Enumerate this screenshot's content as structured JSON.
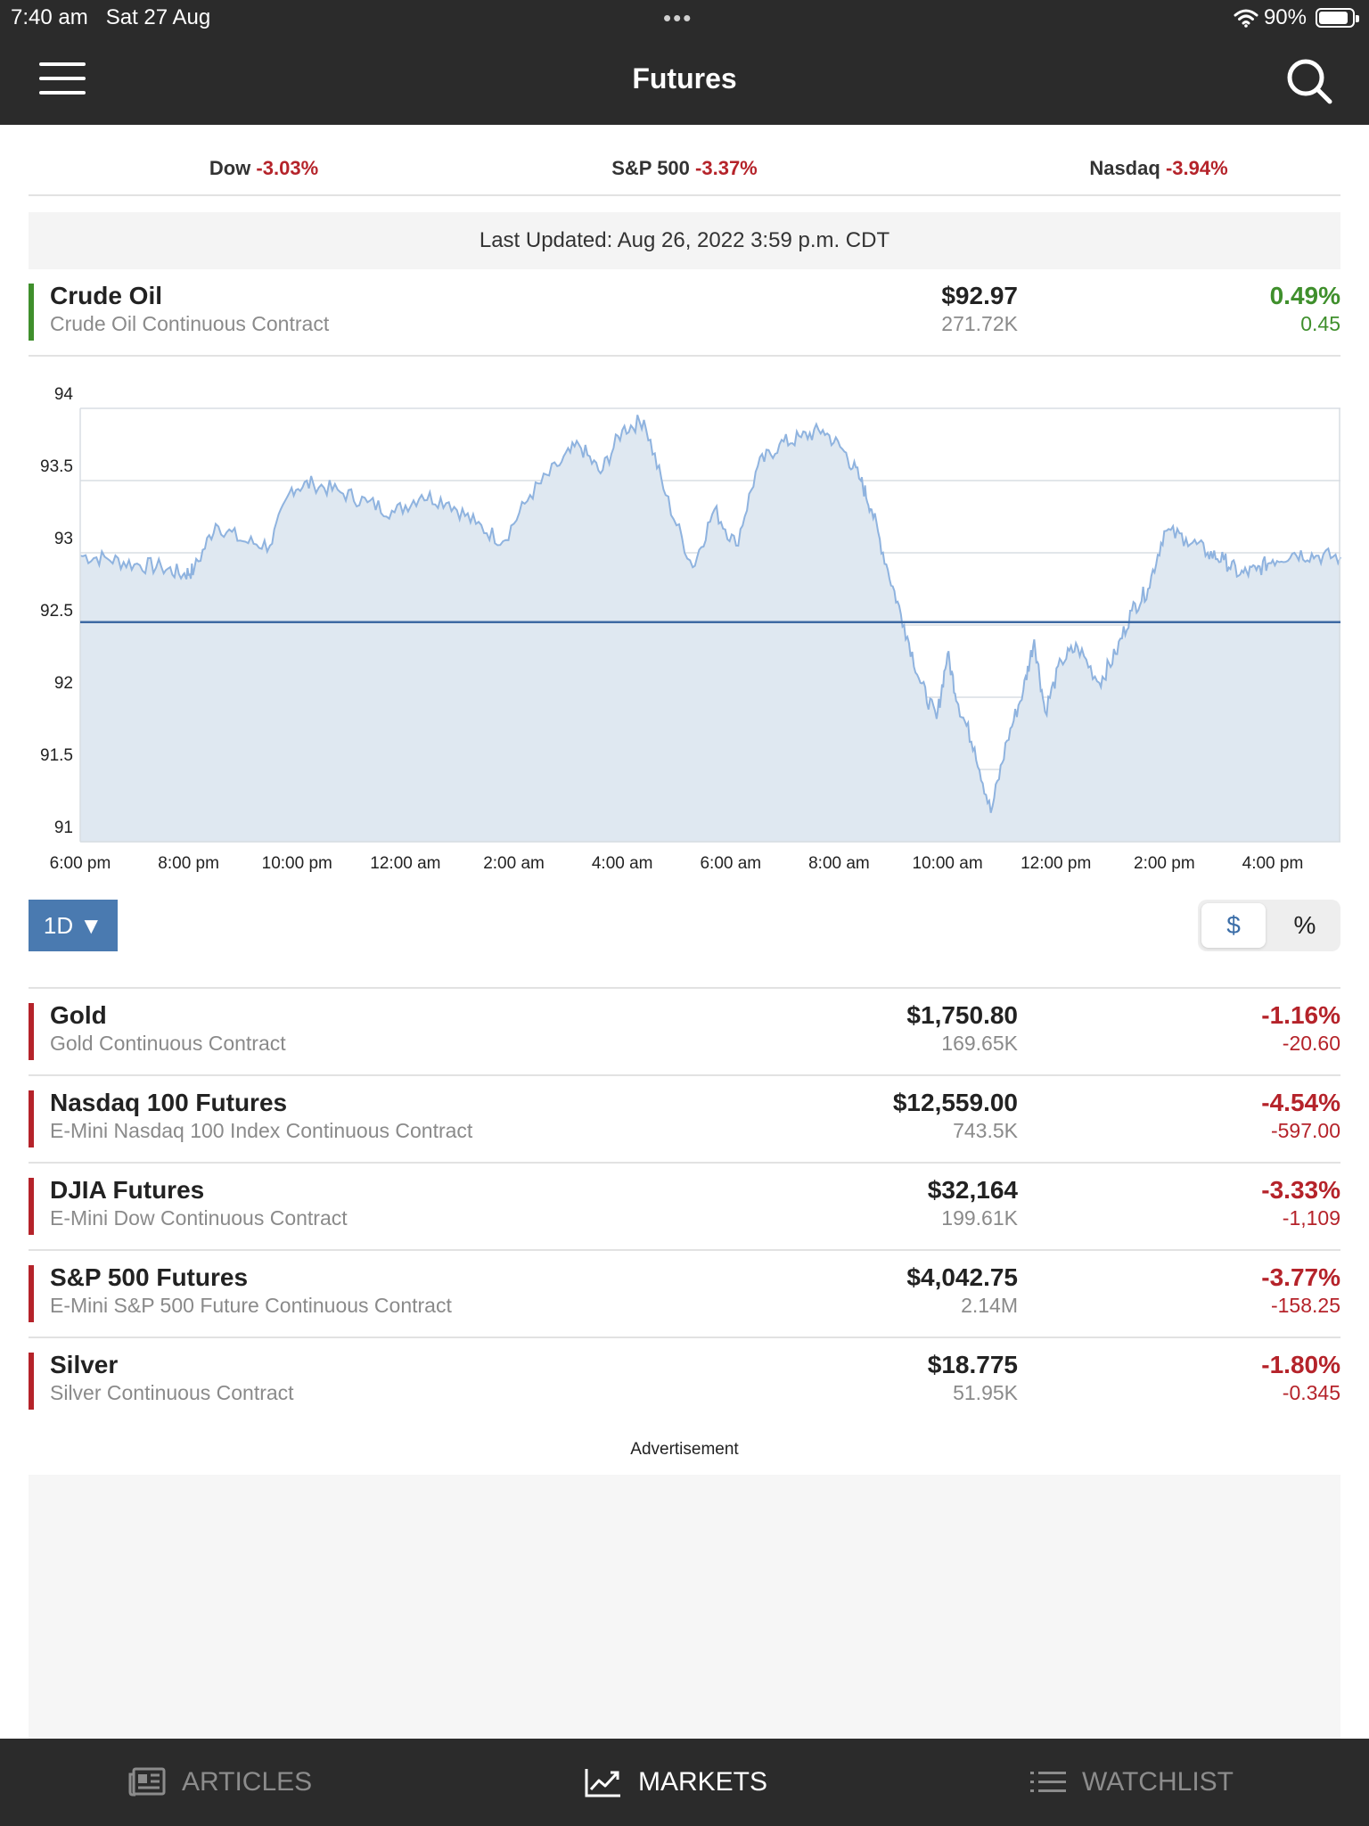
{
  "status_bar": {
    "time": "7:40 am",
    "date": "Sat 27 Aug",
    "battery": "90%",
    "battery_level": 0.9
  },
  "nav": {
    "title": "Futures"
  },
  "indices": [
    {
      "name": "Dow",
      "change": "-3.03%"
    },
    {
      "name": "S&P 500",
      "change": "-3.37%"
    },
    {
      "name": "Nasdaq",
      "change": "-3.94%"
    }
  ],
  "last_updated": "Last Updated: Aug 26, 2022 3:59 p.m. CDT",
  "colors": {
    "up": "#3f8f2c",
    "down": "#b5232a",
    "accent": "#4a7ab0",
    "line": "#8fb3df",
    "fill": "#dfe8f1",
    "ref_line": "#3e6aa3"
  },
  "featured": {
    "name": "Crude Oil",
    "subtitle": "Crude Oil Continuous Contract",
    "price": "$92.97",
    "volume": "271.72K",
    "change_pct": "0.49%",
    "change": "0.45",
    "direction": "up"
  },
  "chart_data": {
    "type": "area",
    "x_tick_labels": [
      "6:00 pm",
      "8:00 pm",
      "10:00 pm",
      "12:00 am",
      "2:00 am",
      "4:00 am",
      "6:00 am",
      "8:00 am",
      "10:00 am",
      "12:00 pm",
      "2:00 pm",
      "4:00 pm"
    ],
    "y_tick_labels": [
      "94",
      "93.5",
      "93",
      "92.5",
      "92",
      "91.5",
      "91"
    ],
    "ylim": [
      91,
      94
    ],
    "xlim_hours": [
      0,
      23.25
    ],
    "reference_line": 92.52,
    "grid": true,
    "x_hours": [
      0,
      0.5,
      1,
      1.5,
      1.9,
      2.1,
      2.5,
      3,
      3.5,
      3.9,
      4.3,
      4.8,
      5.3,
      5.8,
      6.3,
      6.8,
      7.3,
      7.8,
      8.3,
      8.8,
      9.2,
      9.6,
      10,
      10.4,
      10.8,
      11.3,
      11.7,
      12.1,
      12.5,
      12.9,
      13.3,
      13.7,
      14.1,
      14.4,
      14.6,
      14.9,
      15.2,
      15.5,
      15.8,
      16.0,
      16.2,
      16.5,
      16.8,
      17.1,
      17.4,
      17.6,
      17.8,
      18.1,
      18.4,
      18.8,
      19.1,
      19.4,
      19.7,
      20.0,
      20.4,
      20.8,
      21.1,
      21.4,
      21.7,
      22.0,
      22.4,
      22.8,
      23.25
    ],
    "y_values": [
      92.98,
      92.96,
      92.92,
      92.9,
      92.85,
      92.88,
      93.2,
      93.08,
      93.05,
      93.45,
      93.48,
      93.42,
      93.35,
      93.28,
      93.4,
      93.35,
      93.2,
      93.08,
      93.4,
      93.6,
      93.75,
      93.55,
      93.85,
      93.92,
      93.4,
      92.9,
      93.3,
      93.05,
      93.6,
      93.75,
      93.8,
      93.85,
      93.7,
      93.5,
      93.3,
      92.88,
      92.5,
      92.1,
      91.85,
      92.3,
      91.95,
      91.65,
      91.2,
      91.7,
      92.05,
      92.4,
      91.9,
      92.25,
      92.35,
      92.1,
      92.3,
      92.6,
      92.75,
      93.15,
      93.1,
      93.0,
      92.95,
      92.85,
      92.88,
      92.95,
      93.0,
      92.98,
      92.97
    ]
  },
  "range": {
    "label": "1D ▼"
  },
  "toggle": {
    "dollar": "$",
    "percent": "%"
  },
  "quotes": [
    {
      "name": "Gold",
      "subtitle": "Gold Continuous Contract",
      "price": "$1,750.80",
      "volume": "169.65K",
      "change_pct": "-1.16%",
      "change": "-20.60",
      "direction": "down"
    },
    {
      "name": "Nasdaq 100 Futures",
      "subtitle": "E-Mini Nasdaq 100 Index Continuous Contract",
      "price": "$12,559.00",
      "volume": "743.5K",
      "change_pct": "-4.54%",
      "change": "-597.00",
      "direction": "down"
    },
    {
      "name": "DJIA Futures",
      "subtitle": "E-Mini Dow Continuous Contract",
      "price": "$32,164",
      "volume": "199.61K",
      "change_pct": "-3.33%",
      "change": "-1,109",
      "direction": "down"
    },
    {
      "name": "S&P 500 Futures",
      "subtitle": "E-Mini S&P 500 Future Continuous Contract",
      "price": "$4,042.75",
      "volume": "2.14M",
      "change_pct": "-3.77%",
      "change": "-158.25",
      "direction": "down"
    },
    {
      "name": "Silver",
      "subtitle": "Silver Continuous Contract",
      "price": "$18.775",
      "volume": "51.95K",
      "change_pct": "-1.80%",
      "change": "-0.345",
      "direction": "down"
    }
  ],
  "ad_label": "Advertisement",
  "tabs": [
    {
      "label": "ARTICLES",
      "icon": "newspaper-icon",
      "active": false
    },
    {
      "label": "MARKETS",
      "icon": "trend-chart-icon",
      "active": true
    },
    {
      "label": "WATCHLIST",
      "icon": "list-icon",
      "active": false
    }
  ]
}
